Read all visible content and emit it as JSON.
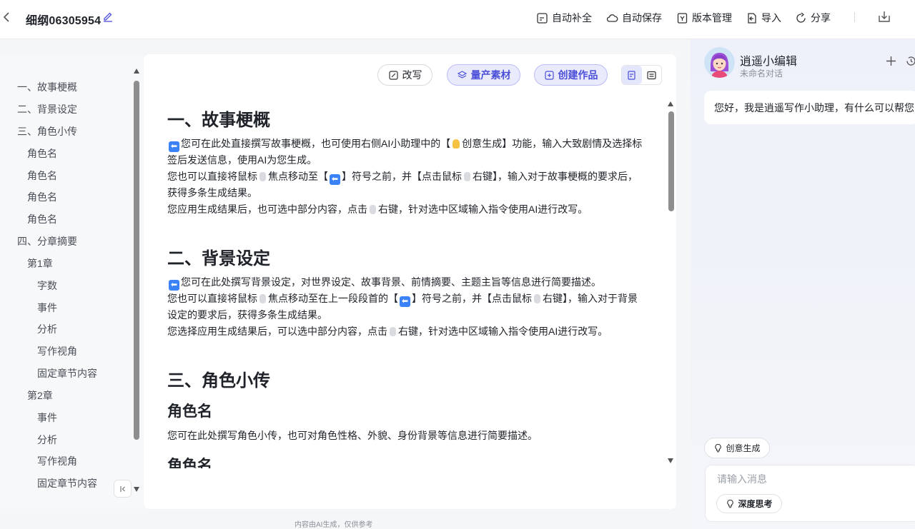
{
  "header": {
    "doc_title": "细纲06305954",
    "tools": {
      "autocomplete": "自动补全",
      "autosave": "自动保存",
      "version": "版本管理",
      "import": "导入",
      "share": "分享"
    }
  },
  "outline": {
    "items": [
      "一、故事梗概",
      "二、背景设定",
      "三、角色小传",
      "角色名",
      "角色名",
      "角色名",
      "角色名",
      "四、分章摘要",
      "第1章",
      "字数",
      "事件",
      "分析",
      "写作视角",
      "固定章节内容",
      "第2章",
      "事件",
      "分析",
      "写作视角",
      "固定章节内容"
    ]
  },
  "editor_toolbar": {
    "rewrite": "改写",
    "mass_material": "量产素材",
    "create_work": "创建作品"
  },
  "document": {
    "section1": {
      "title": "一、故事梗概",
      "p1a": "您可在此处直接撰写故事梗概，也可使用右侧AI小助理中的【",
      "p1b": "创意生成】功能，输入大致剧情及选择标",
      "p1c": "签后发送信息，使用AI为您生成。",
      "p2a": "您也可以直接将鼠标",
      "p2b": "焦点移动至【",
      "p2c": "】符号之前，并【点击鼠标",
      "p2d": "右键】，输入对于故事梗概的要求后，",
      "p2e": "获得多条生成结果。",
      "p3a": "您应用生成结果后，也可选中部分内容，点击",
      "p3b": "右键，针对选中区域输入指令使用AI进行改写。"
    },
    "section2": {
      "title": "二、背景设定",
      "p1": "您可在此处撰写背景设定，对世界设定、故事背景、前情摘要、主题主旨等信息进行简要描述。",
      "p2a": "您也可以直接将鼠标",
      "p2b": "焦点移动至在上一段段首的【",
      "p2c": "】符号之前，并【点击鼠标",
      "p2d": "右键】，输入对于背景",
      "p2e": "设定的要求后，获得多条生成结果。",
      "p3a": "您选择应用生成结果后，可以选中部分内容，点击",
      "p3b": "右键，针对选中区域输入指令使用AI进行改写。"
    },
    "section3": {
      "title": "三、角色小传",
      "role1_title": "角色名",
      "role1_desc": "您可在此处撰写角色小传，也可对角色性格、外貌、身份背景等信息进行简要描述。",
      "role2_title": "角色名"
    },
    "arrow_glyph": "⬅"
  },
  "footnote": "内容由AI生成，仅供参考",
  "assistant": {
    "name": "逍遥小编辑",
    "subtitle": "未命名对话",
    "greeting": "您好，我是逍遥写作小助理，有什么可以帮您",
    "chip_create": "创意生成",
    "input_placeholder": "请输入消息",
    "deep_think": "深度思考"
  },
  "colors": {
    "accent": "#4b4fd8",
    "accent_bg": "#eaeafd",
    "badge_blue": "#3b82f6"
  }
}
